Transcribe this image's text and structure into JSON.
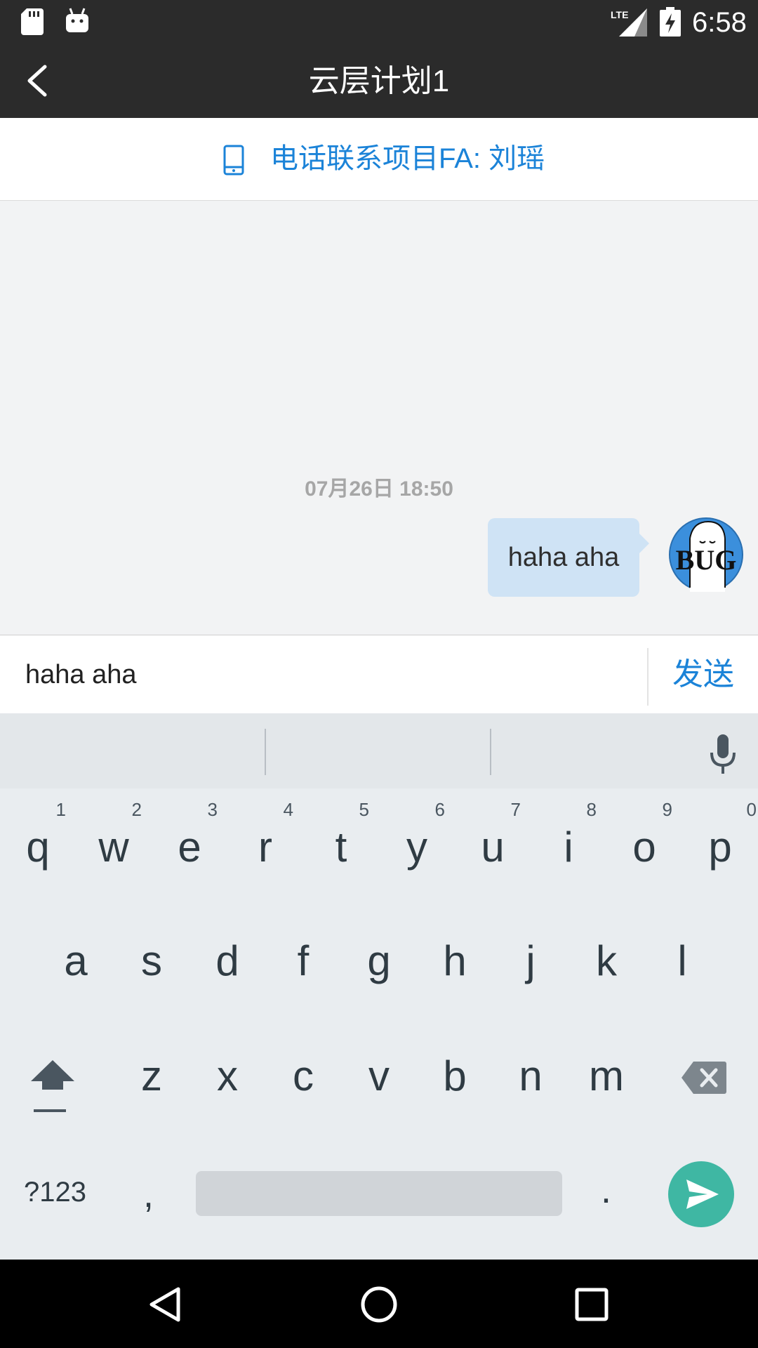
{
  "status_bar": {
    "time": "6:58",
    "network": "LTE",
    "icons": [
      "sd-card-icon",
      "android-icon",
      "lte-signal-icon",
      "battery-charging-icon"
    ]
  },
  "toolbar": {
    "title": "云层计划1",
    "back_icon": "back-arrow-icon"
  },
  "contact_bar": {
    "text": "电话联系项目FA: 刘瑶",
    "icon": "phone-icon",
    "color": "#1b83d8"
  },
  "chat": {
    "timestamp": "07月26日 18:50",
    "messages": [
      {
        "text": "haha aha",
        "outgoing": true,
        "avatar_label": "BUG"
      }
    ]
  },
  "input": {
    "value": "haha aha",
    "send_label": "发送"
  },
  "keyboard": {
    "row1": [
      {
        "ch": "q",
        "num": "1"
      },
      {
        "ch": "w",
        "num": "2"
      },
      {
        "ch": "e",
        "num": "3"
      },
      {
        "ch": "r",
        "num": "4"
      },
      {
        "ch": "t",
        "num": "5"
      },
      {
        "ch": "y",
        "num": "6"
      },
      {
        "ch": "u",
        "num": "7"
      },
      {
        "ch": "i",
        "num": "8"
      },
      {
        "ch": "o",
        "num": "9"
      },
      {
        "ch": "p",
        "num": "0"
      }
    ],
    "row2": [
      "a",
      "s",
      "d",
      "f",
      "g",
      "h",
      "j",
      "k",
      "l"
    ],
    "row3": [
      "z",
      "x",
      "c",
      "v",
      "b",
      "n",
      "m"
    ],
    "symbols_label": "?123",
    "comma": ",",
    "period": ".",
    "accent": "#3fb7a3"
  },
  "nav_bar": {
    "icons": [
      "back-triangle-icon",
      "home-circle-icon",
      "recents-square-icon"
    ]
  }
}
